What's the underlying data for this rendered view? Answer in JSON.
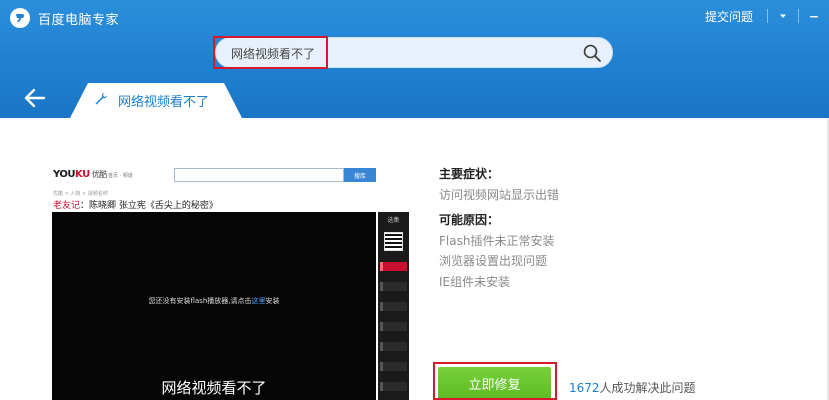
{
  "app": {
    "title": "百度电脑专家",
    "feedback_label": "提交问题"
  },
  "search": {
    "value": "网络视频看不了"
  },
  "tab": {
    "label": "网络视频看不了"
  },
  "preview": {
    "logo_en_a": "YOU",
    "logo_en_b": "KU",
    "logo_cn": "优酷",
    "nav_text": "首页  · 频道",
    "search_button": "搜库",
    "breadcrumb": "优酷 > 人物 > 视频名称",
    "title_prefix": "老友记",
    "title_rest": "：陈晓卿 张立宪《舌尖上的秘密》",
    "player_msg_a": "您还没有安装flash播放器,请点击",
    "player_msg_link": "这里",
    "player_msg_b": "安装",
    "player_caption": "网络视频看不了",
    "rail_label": "选集"
  },
  "info": {
    "symptoms_title": "主要症状：",
    "symptoms": [
      "访问视频网站显示出错"
    ],
    "causes_title": "可能原因：",
    "causes": [
      "Flash插件未正常安装",
      "浏览器设置出现问题",
      "IE组件未安装"
    ]
  },
  "action": {
    "fix_label": "立即修复",
    "solved_count": "1672",
    "solved_suffix": "人成功解决此问题"
  },
  "colors": {
    "header_blue": "#2b8fdb",
    "accent_blue": "#1a7fd4",
    "highlight_red": "#d8182e",
    "fix_green": "#5cbb22"
  },
  "icons": [
    "baidu-logo-icon",
    "minimize-icon",
    "dropdown-icon",
    "search-icon",
    "back-arrow-icon",
    "wrench-icon"
  ]
}
